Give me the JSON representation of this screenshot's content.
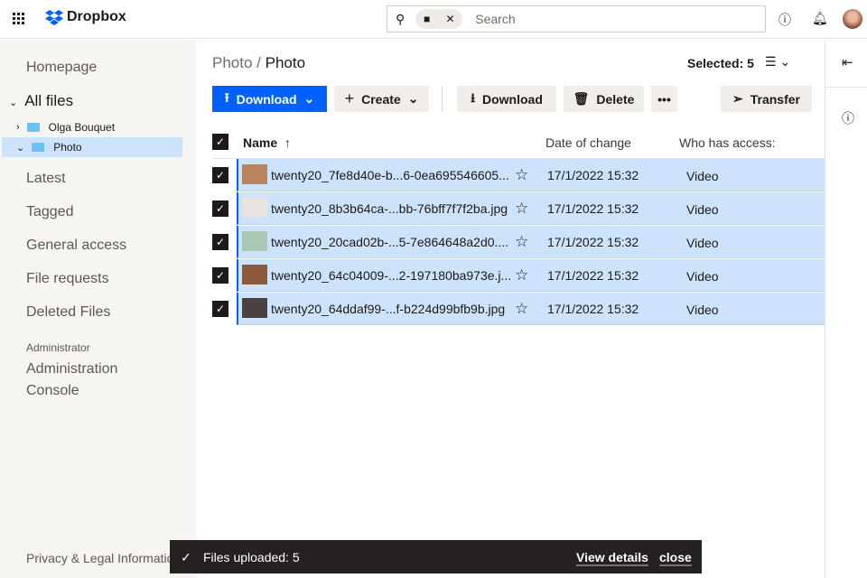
{
  "header": {
    "logo": "Dropbox",
    "search_placeholder": "Search"
  },
  "sidebar": {
    "homepage": "Homepage",
    "all_files": "All files",
    "tree": [
      {
        "label": "Olga Bouquet"
      },
      {
        "label": "Photo"
      }
    ],
    "items": [
      "Latest",
      "Tagged",
      "General access",
      "File requests",
      "Deleted Files"
    ],
    "admin_heading": "Administrator",
    "admin_line1": "Administration",
    "admin_line2": "Console",
    "privacy": "Privacy & Legal Information"
  },
  "main": {
    "breadcrumb_parent": "Photo",
    "breadcrumb_sep": "/",
    "breadcrumb_current": "Photo",
    "selected": "Selected: 5",
    "toolbar": {
      "upload": "Download",
      "create": "Create",
      "download": "Download",
      "delete": "Delete",
      "more": "•••",
      "transfer": "Transfer"
    },
    "columns": {
      "name": "Name",
      "date": "Date of change",
      "access": "Who has access:"
    },
    "files": [
      {
        "name": "twenty20_7fe8d40e-b...6-0ea695546605...",
        "date": "17/1/2022 15:32",
        "access": "Video",
        "thumb": "#b8835f"
      },
      {
        "name": "twenty20_8b3b64ca-...bb-76bff7f7f2ba.jpg",
        "date": "17/1/2022 15:32",
        "access": "Video",
        "thumb": "#e9e4df"
      },
      {
        "name": "twenty20_20cad02b-...5-7e864648a2d0....",
        "date": "17/1/2022 15:32",
        "access": "Video",
        "thumb": "#a9c8b6"
      },
      {
        "name": "twenty20_64c04009-...2-197180ba973e.j...",
        "date": "17/1/2022 15:32",
        "access": "Video",
        "thumb": "#8b5a3e"
      },
      {
        "name": "twenty20_64ddaf99-...f-b224d99bfb9b.jpg",
        "date": "17/1/2022 15:32",
        "access": "Video",
        "thumb": "#4a4140"
      }
    ]
  },
  "toast": {
    "message": "Files uploaded: 5",
    "view_details": "View details",
    "close": "close"
  },
  "colors": {
    "accent": "#0061fe",
    "selected_row": "#cde3fb",
    "sidebar": "#f7f5f2"
  }
}
